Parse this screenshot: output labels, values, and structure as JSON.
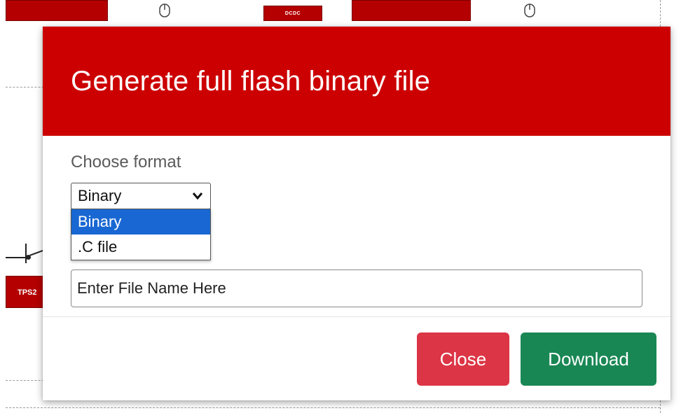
{
  "background": {
    "dcdc_label": "DCDC",
    "tps_label": "TPS2"
  },
  "modal": {
    "title": "Generate full flash binary file",
    "format_label": "Choose format",
    "format_select": {
      "selected": "Binary",
      "options": [
        "Binary",
        ".C file"
      ]
    },
    "filename_input": {
      "value": "",
      "placeholder": "Enter File Name Here"
    },
    "buttons": {
      "close": "Close",
      "download": "Download"
    }
  },
  "colors": {
    "header": "#cc0000",
    "close": "#dc3545",
    "download": "#198754",
    "option_highlight": "#1967d2"
  },
  "icons": [
    "power-icon",
    "chevron-down-icon"
  ]
}
